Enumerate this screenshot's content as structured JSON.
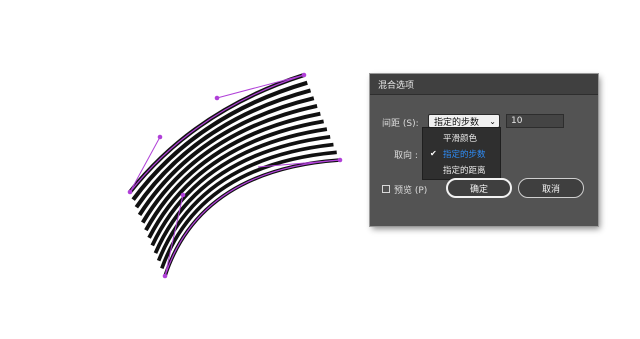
{
  "dialog": {
    "title": "混合选项",
    "spacing_label": "间距 (S):",
    "spacing_selected": "指定的步数",
    "steps_value": "10",
    "orientation_label": "取向 :",
    "menu_options": [
      "平滑颜色",
      "指定的步数",
      "指定的距离"
    ],
    "menu_selected_index": 1,
    "preview_label": "预览 (P)",
    "preview_checked": false,
    "ok_label": "确定",
    "cancel_label": "取消"
  },
  "artwork": {
    "line_count": 12,
    "stroke_color": "#111111",
    "path_color": "#b040d8"
  },
  "colors": {
    "dialog_bg": "#535353",
    "titlebar_bg": "#404040",
    "menu_bg": "#2f2f2f",
    "selected_item": "#2f8cf6"
  }
}
